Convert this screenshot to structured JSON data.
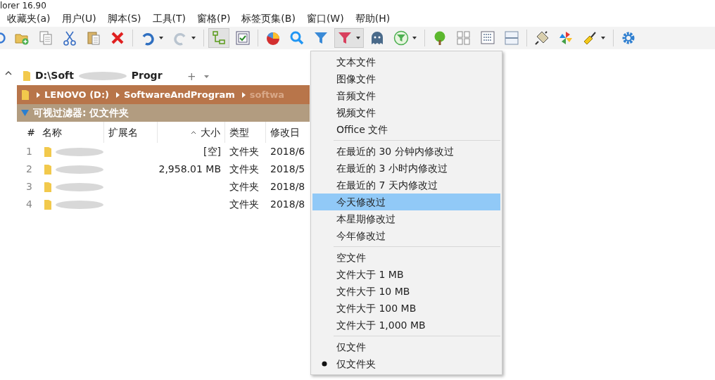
{
  "window": {
    "title": "lorer 16.90"
  },
  "menu_bar": [
    "收藏夹(a)",
    "用户(U)",
    "脚本(S)",
    "工具(T)",
    "窗格(P)",
    "标签页集(B)",
    "窗口(W)",
    "帮助(H)"
  ],
  "toolbar": [
    {
      "pressed": false,
      "dropdown": false
    },
    {
      "pressed": false,
      "dropdown": false
    },
    {
      "pressed": false,
      "dropdown": false
    },
    {
      "pressed": false,
      "dropdown": false
    },
    {
      "pressed": false,
      "dropdown": false
    },
    {
      "pressed": false,
      "dropdown": false
    },
    {
      "pressed": false,
      "dropdown": true
    },
    {
      "pressed": false,
      "dropdown": true
    },
    {
      "pressed": true,
      "dropdown": false
    },
    {
      "pressed": false,
      "dropdown": false
    },
    {
      "pressed": false,
      "dropdown": false
    },
    {
      "pressed": false,
      "dropdown": false
    },
    {
      "pressed": false,
      "dropdown": false
    },
    {
      "pressed": true,
      "dropdown": true
    },
    {
      "pressed": false,
      "dropdown": false
    },
    {
      "pressed": false,
      "dropdown": true
    },
    {
      "pressed": false,
      "dropdown": false
    },
    {
      "pressed": false,
      "dropdown": false
    },
    {
      "pressed": false,
      "dropdown": false
    },
    {
      "pressed": false,
      "dropdown": false
    },
    {
      "pressed": false,
      "dropdown": false
    },
    {
      "pressed": false,
      "dropdown": false
    },
    {
      "pressed": false,
      "dropdown": true
    },
    {
      "pressed": false,
      "dropdown": false
    }
  ],
  "tab": {
    "label": "D:\\Soft",
    "label_end": "Progr",
    "selected": true,
    "add": "+"
  },
  "breadcrumb": [
    "LENOVO (D:)",
    "SoftwareAndProgram",
    "softwa"
  ],
  "filter_bar": {
    "label": "可视过滤器: 仅文件夹"
  },
  "table": {
    "columns": [
      "#",
      "名称",
      "扩展名",
      "大小",
      "类型",
      "修改日"
    ],
    "rows": [
      {
        "index": "1",
        "size": "[空]",
        "type": "文件夹",
        "modified": "2018/6"
      },
      {
        "index": "2",
        "size": "2,958.01 MB",
        "type": "文件夹",
        "modified": "2018/5"
      },
      {
        "index": "3",
        "size": "",
        "type": "文件夹",
        "modified": "2018/8"
      },
      {
        "index": "4",
        "size": "",
        "type": "文件夹",
        "modified": "2018/8"
      }
    ]
  },
  "dropdown_menu": [
    [
      {
        "label": "文本文件",
        "selected": false,
        "checked": false
      },
      {
        "label": "图像文件",
        "selected": false,
        "checked": false
      },
      {
        "label": "音频文件",
        "selected": false,
        "checked": false
      },
      {
        "label": "视频文件",
        "selected": false,
        "checked": false
      },
      {
        "label": "Office 文件",
        "selected": false,
        "checked": false
      }
    ],
    [
      {
        "label": "在最近的 30 分钟内修改过",
        "selected": false,
        "checked": false
      },
      {
        "label": "在最近的 3 小时内修改过",
        "selected": false,
        "checked": false
      },
      {
        "label": "在最近的 7 天内修改过",
        "selected": false,
        "checked": false
      },
      {
        "label": "今天修改过",
        "selected": true,
        "checked": false
      },
      {
        "label": "本星期修改过",
        "selected": false,
        "checked": false
      },
      {
        "label": "今年修改过",
        "selected": false,
        "checked": false
      }
    ],
    [
      {
        "label": "空文件",
        "selected": false,
        "checked": false
      },
      {
        "label": "文件大于 1 MB",
        "selected": false,
        "checked": false
      },
      {
        "label": "文件大于 10 MB",
        "selected": false,
        "checked": false
      },
      {
        "label": "文件大于 100 MB",
        "selected": false,
        "checked": false
      },
      {
        "label": "文件大于 1,000 MB",
        "selected": false,
        "checked": false
      }
    ],
    [
      {
        "label": "仅文件",
        "selected": false,
        "checked": false
      },
      {
        "label": "仅文件夹",
        "selected": false,
        "checked": true
      }
    ]
  ]
}
